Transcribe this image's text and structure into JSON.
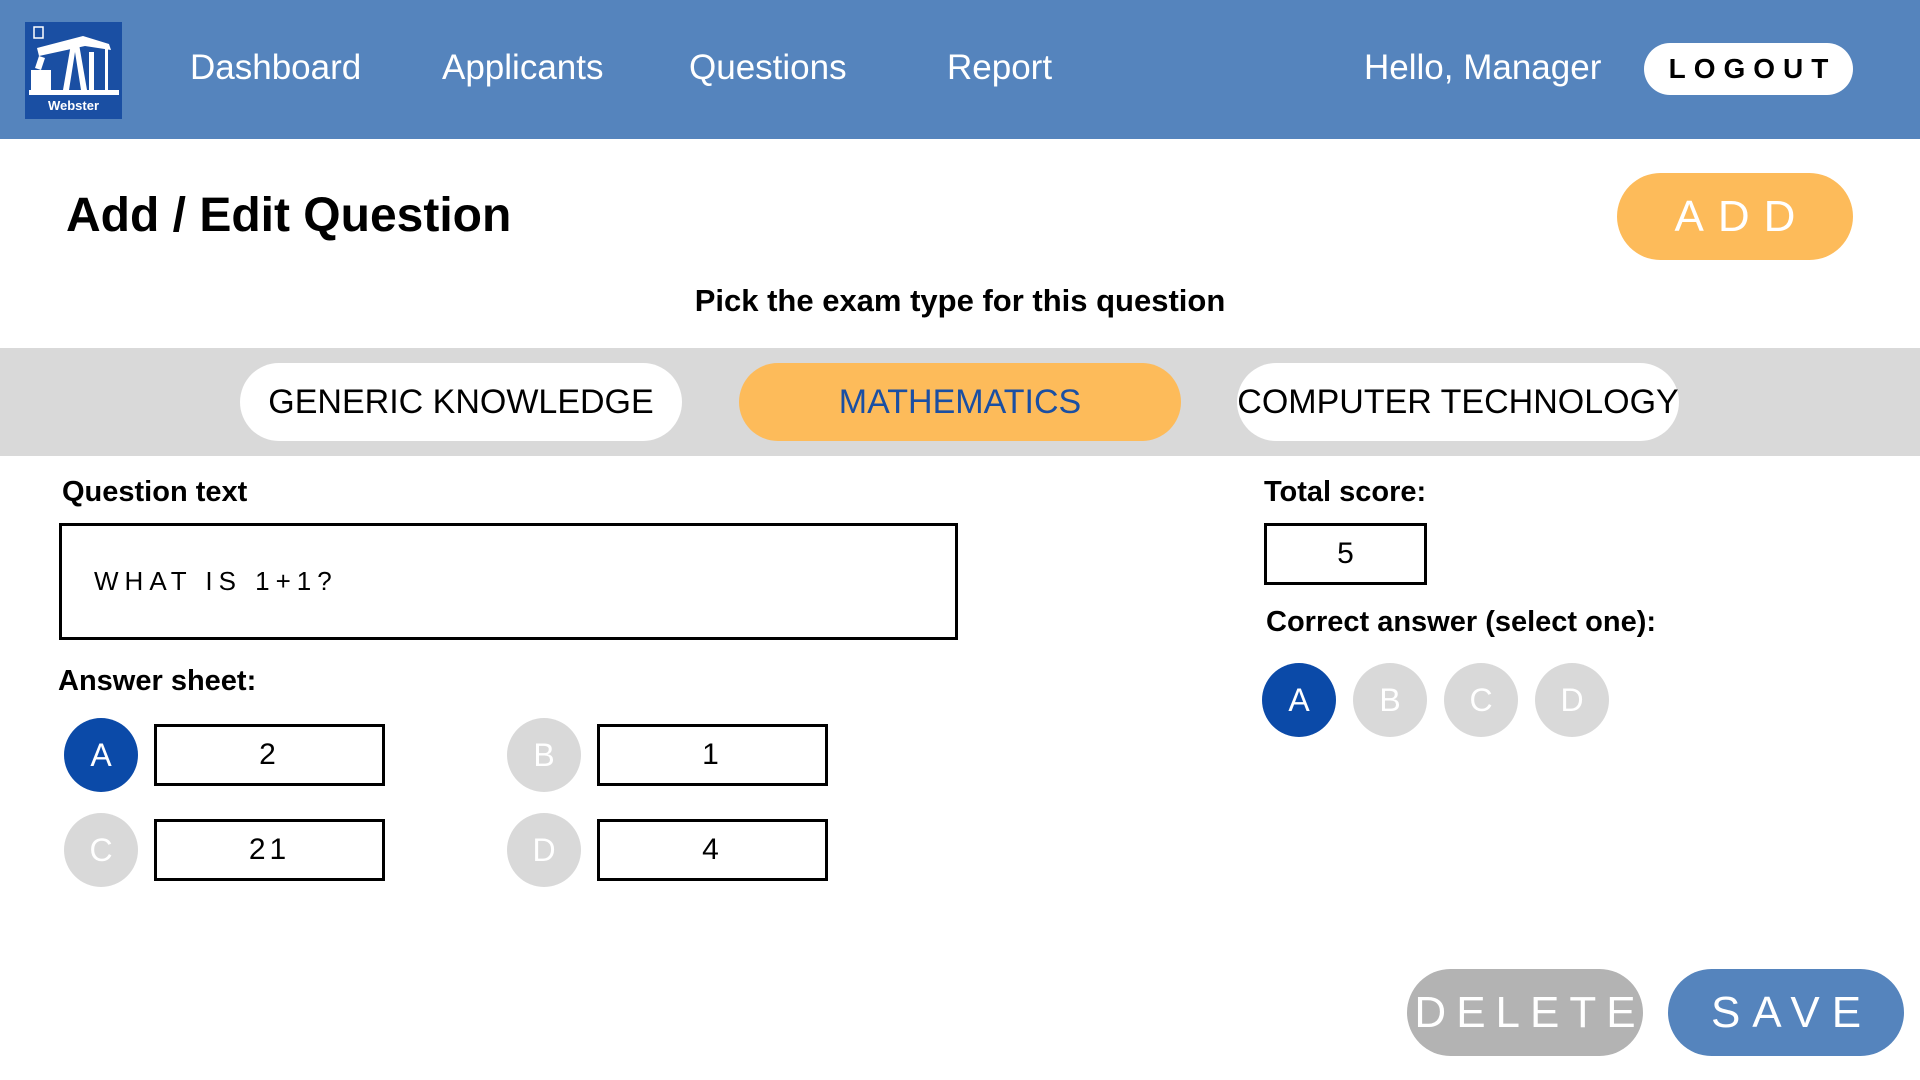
{
  "header": {
    "logo": {
      "text": "Webster",
      "icon": "oil-pumpjack-icon"
    },
    "nav": [
      {
        "label": "Dashboard"
      },
      {
        "label": "Applicants"
      },
      {
        "label": "Questions"
      },
      {
        "label": "Report"
      }
    ],
    "greeting": "Hello, Manager",
    "logout_label": "LOGOUT"
  },
  "page": {
    "title": "Add / Edit Question",
    "add_label": "ADD",
    "exam_type_prompt": "Pick the exam type for this question"
  },
  "exam_types": [
    {
      "label": "GENERIC KNOWLEDGE",
      "selected": false
    },
    {
      "label": "MATHEMATICS",
      "selected": true
    },
    {
      "label": "COMPUTER TECHNOLOGY",
      "selected": false
    }
  ],
  "question": {
    "label": "Question text",
    "value": "WHAT IS 1+1?"
  },
  "answer_sheet": {
    "label": "Answer sheet:",
    "choices": [
      {
        "letter": "A",
        "value": "2",
        "selected": true
      },
      {
        "letter": "B",
        "value": "1",
        "selected": false
      },
      {
        "letter": "C",
        "value": "21",
        "selected": false
      },
      {
        "letter": "D",
        "value": "4",
        "selected": false
      }
    ]
  },
  "score": {
    "label": "Total score:",
    "value": "5"
  },
  "correct_answer": {
    "label": "Correct answer (select one):",
    "options": [
      {
        "letter": "A",
        "selected": true
      },
      {
        "letter": "B",
        "selected": false
      },
      {
        "letter": "C",
        "selected": false
      },
      {
        "letter": "D",
        "selected": false
      }
    ]
  },
  "actions": {
    "delete_label": "DELETE",
    "save_label": "SAVE"
  },
  "colors": {
    "header_blue": "#5584bd",
    "accent_orange": "#fdbb5a",
    "selected_blue": "#0b4aa8",
    "inactive_gray": "#d9d9d9",
    "delete_gray": "#b3b3b3"
  }
}
